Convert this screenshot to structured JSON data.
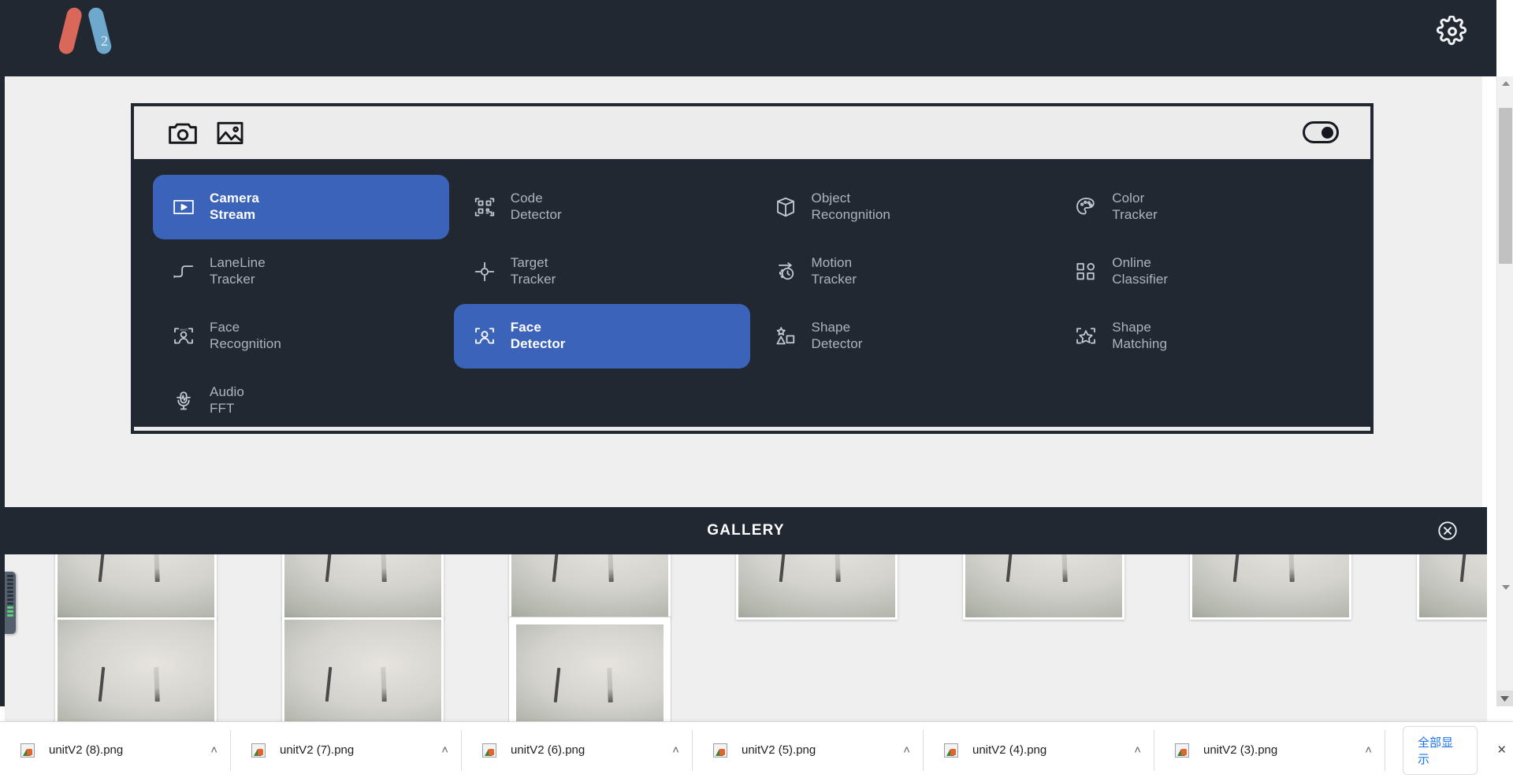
{
  "header": {
    "logo_alt": "V2",
    "logo_subscript": "2",
    "logo_colors": {
      "left": "#d9675a",
      "right": "#74b3d8"
    },
    "settings_icon": "gear-icon"
  },
  "card": {
    "toolbar": {
      "camera_icon": "camera-icon",
      "image_icon": "image-icon",
      "toggle_icon": "toggle-switch-on",
      "toggle_state": "on"
    },
    "modules": [
      {
        "l1": "Camera",
        "l2": "Stream",
        "icon": "play-frame-icon",
        "active": true
      },
      {
        "l1": "Code",
        "l2": "Detector",
        "icon": "qr-code-icon",
        "active": false
      },
      {
        "l1": "Object",
        "l2": "Recongnition",
        "icon": "cube-icon",
        "active": false
      },
      {
        "l1": "Color",
        "l2": "Tracker",
        "icon": "palette-icon",
        "active": false
      },
      {
        "l1": "LaneLine",
        "l2": "Tracker",
        "icon": "lane-line-icon",
        "active": false
      },
      {
        "l1": "Target",
        "l2": "Tracker",
        "icon": "crosshair-icon",
        "active": false
      },
      {
        "l1": "Motion",
        "l2": "Tracker",
        "icon": "motion-arrow-icon",
        "active": false
      },
      {
        "l1": "Online",
        "l2": "Classifier",
        "icon": "grid-shapes-icon",
        "active": false
      },
      {
        "l1": "Face",
        "l2": "Recognition",
        "icon": "face-who-icon",
        "active": false
      },
      {
        "l1": "Face",
        "l2": "Detector",
        "icon": "face-frame-icon",
        "active": true
      },
      {
        "l1": "Shape",
        "l2": "Detector",
        "icon": "shapes-icon",
        "active": false
      },
      {
        "l1": "Shape",
        "l2": "Matching",
        "icon": "star-frame-icon",
        "active": false
      },
      {
        "l1": "Audio",
        "l2": "FFT",
        "icon": "microphone-icon",
        "active": false
      }
    ],
    "accent_color": "#3b63ba",
    "panel_color": "#222831"
  },
  "gallery": {
    "title": "GALLERY",
    "close_icon": "close-circle-icon",
    "row1_count": 7,
    "row2_count": 3,
    "selected_index": 2,
    "download_icon": "download-arrow-icon",
    "delete_icon": "delete-x-icon",
    "download_color": "#1e8a22",
    "delete_color": "#e8252a"
  },
  "scrollbars": {
    "v_up_icon": "triangle-up-icon",
    "v_down_icon": "triangle-down-icon",
    "h_left_icon": "triangle-left-icon",
    "h_right_icon": "triangle-right-icon"
  },
  "side_widget": {
    "name": "equalizer-widget"
  },
  "downloads": {
    "items": [
      {
        "name": "unitV2 (8).png",
        "icon": "png-file-icon",
        "caret": "˄"
      },
      {
        "name": "unitV2 (7).png",
        "icon": "png-file-icon",
        "caret": "˄"
      },
      {
        "name": "unitV2 (6).png",
        "icon": "png-file-icon",
        "caret": "˄"
      },
      {
        "name": "unitV2 (5).png",
        "icon": "png-file-icon",
        "caret": "˄"
      },
      {
        "name": "unitV2 (4).png",
        "icon": "png-file-icon",
        "caret": "˄"
      },
      {
        "name": "unitV2 (3).png",
        "icon": "png-file-icon",
        "caret": "˄"
      }
    ],
    "show_all_label": "全部显示",
    "close_label": "×"
  }
}
